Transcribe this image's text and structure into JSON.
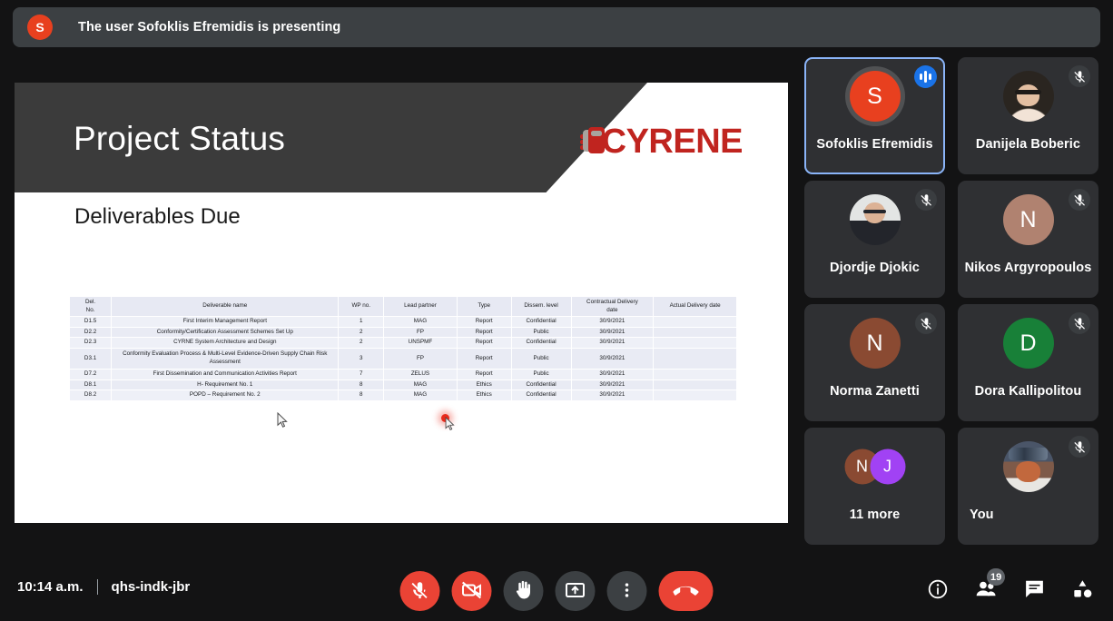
{
  "banner": {
    "avatar_letter": "S",
    "avatar_color": "#e8401f",
    "prefix": "The user ",
    "presenter": "Sofoklis Efremidis",
    "suffix": " is presenting"
  },
  "slide": {
    "title": "Project Status",
    "subtitle": "Deliverables Due",
    "logo_text": "CYRENE",
    "logo_color": "#c0241f",
    "table": {
      "headers": [
        "Del. No.",
        "Deliverable name",
        "WP no.",
        "Lead partner",
        "Type",
        "Dissem. level",
        "Contractual Delivery date",
        "Actual Delivery date"
      ],
      "header_del_line1": "Del.",
      "header_del_line2": "No.",
      "header_cdate_line1": "Contractual Delivery",
      "header_cdate_line2": "date",
      "rows": [
        {
          "del": "D1.5",
          "name": "First Interim Management Report",
          "wp": "1",
          "lead": "MAG",
          "type": "Report",
          "dissem": "Confidential",
          "cdate": "30/9/2021",
          "adate": ""
        },
        {
          "del": "D2.2",
          "name": "Conformity/Certification Assessment Schemes Set Up",
          "wp": "2",
          "lead": "FP",
          "type": "Report",
          "dissem": "Public",
          "cdate": "30/9/2021",
          "adate": ""
        },
        {
          "del": "D2.3",
          "name": "CYRNE System Architecture and Design",
          "wp": "2",
          "lead": "UNSPMF",
          "type": "Report",
          "dissem": "Confidential",
          "cdate": "30/9/2021",
          "adate": ""
        },
        {
          "del": "D3.1",
          "name": "Conformity Evaluation Process & Multi-Level Evidence-Driven Supply Chain Risk Assessment",
          "wp": "3",
          "lead": "FP",
          "type": "Report",
          "dissem": "Public",
          "cdate": "30/9/2021",
          "adate": "",
          "tall": true
        },
        {
          "del": "D7.2",
          "name": "First Dissemination and Communication Activities Report",
          "wp": "7",
          "lead": "ZELUS",
          "type": "Report",
          "dissem": "Public",
          "cdate": "30/9/2021",
          "adate": ""
        },
        {
          "del": "D8.1",
          "name": "H- Requirement No. 1",
          "wp": "8",
          "lead": "MAG",
          "type": "Ethics",
          "dissem": "Confidential",
          "cdate": "30/9/2021",
          "adate": ""
        },
        {
          "del": "D8.2",
          "name": "POPD – Requirement No. 2",
          "wp": "8",
          "lead": "MAG",
          "type": "Ethics",
          "dissem": "Confidential",
          "cdate": "30/9/2021",
          "adate": ""
        }
      ]
    }
  },
  "participants": [
    {
      "name": "Sofoklis Efremidis",
      "initial": "S",
      "avatar_color": "#e8401f",
      "kind": "initial",
      "speaking": true,
      "muted": false,
      "active": true
    },
    {
      "name": "Danijela Boberic",
      "initial": "D",
      "kind": "photo",
      "photo": "ph-danijela",
      "speaking": false,
      "muted": true,
      "active": false
    },
    {
      "name": "Djordje Djokic",
      "initial": "D",
      "kind": "photo",
      "photo": "ph-djordje",
      "speaking": false,
      "muted": true,
      "active": false
    },
    {
      "name": "Nikos Argyropoulos",
      "initial": "N",
      "avatar_color": "#b08270",
      "kind": "initial",
      "speaking": false,
      "muted": true,
      "active": false
    },
    {
      "name": "Norma Zanetti",
      "initial": "N",
      "avatar_color": "#8a4a32",
      "kind": "initial",
      "speaking": false,
      "muted": true,
      "active": false
    },
    {
      "name": "Dora Kallipolitou",
      "initial": "D",
      "avatar_color": "#188038",
      "kind": "initial",
      "speaking": false,
      "muted": true,
      "active": false
    },
    {
      "name": "11 more",
      "kind": "more",
      "stack": [
        {
          "initial": "N",
          "avatar_color": "#8a4a32"
        },
        {
          "initial": "J",
          "avatar_color": "#a142f4"
        }
      ],
      "speaking": false,
      "muted": false,
      "active": false
    },
    {
      "name": "You",
      "kind": "photo",
      "photo": "ph-you",
      "speaking": false,
      "muted": true,
      "active": false,
      "name_left": true
    }
  ],
  "bottom": {
    "time": "10:14 a.m.",
    "meeting_code": "qhs-indk-jbr",
    "controls": [
      {
        "name": "microphone-off-button",
        "icon": "mic-off",
        "state": "off"
      },
      {
        "name": "camera-off-button",
        "icon": "cam-off",
        "state": "off"
      },
      {
        "name": "raise-hand-button",
        "icon": "hand",
        "state": "on"
      },
      {
        "name": "present-screen-button",
        "icon": "present",
        "state": "on"
      },
      {
        "name": "more-options-button",
        "icon": "more-vert",
        "state": "on"
      },
      {
        "name": "leave-call-button",
        "icon": "hangup",
        "state": "danger"
      }
    ],
    "right_controls": [
      {
        "name": "meeting-details-button",
        "icon": "info",
        "badge": ""
      },
      {
        "name": "show-everyone-button",
        "icon": "people",
        "badge": "19"
      },
      {
        "name": "chat-button",
        "icon": "chat",
        "badge": ""
      },
      {
        "name": "activities-button",
        "icon": "activities",
        "badge": ""
      }
    ]
  }
}
